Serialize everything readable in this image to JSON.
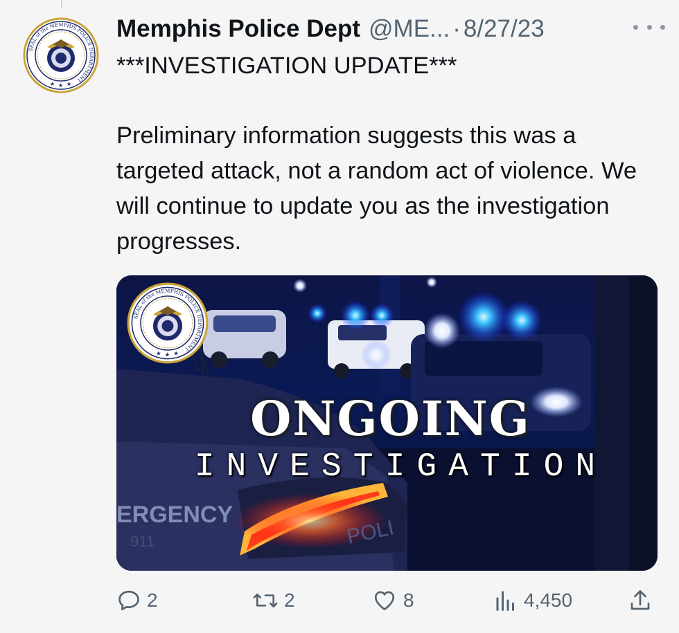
{
  "tweet": {
    "author_name": "Memphis Police Dept",
    "handle": "@ME...",
    "separator": "·",
    "date": "8/27/23",
    "heading": "***INVESTIGATION UPDATE***",
    "body": "Preliminary information suggests this was a targeted attack, not a random act of violence. We will continue to update you as the investigation progresses."
  },
  "media": {
    "title_line1": "ONGOING",
    "title_line2": "INVESTIGATION",
    "vehicle_text_left": "ERGENCY",
    "vehicle_text_right": "POLI",
    "vehicle_text_small": "911"
  },
  "seal": {
    "text": "SEAL of the MEMPHIS POLICE DEPARTMENT"
  },
  "actions": {
    "replies": "2",
    "reposts": "2",
    "likes": "8",
    "views": "4,450"
  },
  "colors": {
    "secondary_text": "#536471",
    "primary_text": "#0f1419",
    "seal_navy": "#1d2a6b",
    "seal_gold": "#c9a53a"
  },
  "icons": {
    "reply": "reply-icon",
    "repost": "repost-icon",
    "like": "like-icon",
    "views": "views-icon",
    "share": "share-icon",
    "more": "more-icon"
  }
}
